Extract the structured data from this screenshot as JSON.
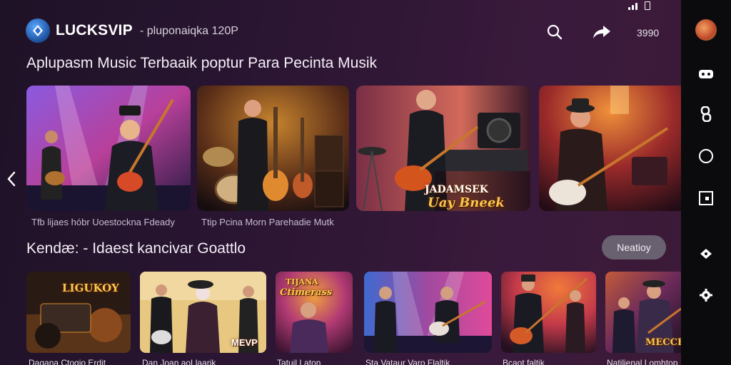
{
  "status_bar": {
    "icons": [
      "signal-icon",
      "battery-icon"
    ]
  },
  "header": {
    "app_name": "LUCKSVIP",
    "app_subtitle": "- pluponaiqka 120P",
    "count": "3990",
    "icons": [
      "search-icon",
      "share-icon"
    ]
  },
  "section1": {
    "title": "Aplupasm Music Terbaaik poptur Para Pecinta Musik",
    "cards": [
      {
        "caption": "Tfb lijaes hóbr Uoestockna Fdeady",
        "palette": [
          "#7a4fd0",
          "#d63a8e",
          "#2a2050"
        ]
      },
      {
        "caption": "Ttip Pcina Morn Parehadie Mutk",
        "palette": [
          "#6b3a20",
          "#c7842e",
          "#1a1014"
        ]
      },
      {
        "caption": "",
        "poster": "JADAMSEK\nUay Bneek",
        "palette": [
          "#a8465a",
          "#e58a4f",
          "#241426"
        ]
      },
      {
        "caption": "",
        "palette": [
          "#b83c2a",
          "#f0913a",
          "#2a1018"
        ]
      }
    ]
  },
  "section2": {
    "title": "Kendæ: - Idaest kancivar Goattlo",
    "more_label": "Neatioy",
    "cards": [
      {
        "caption": "Dagana Ctogio Erdit",
        "poster": "LIGUKOY",
        "palette": [
          "#8a4a1e",
          "#2a1a14",
          "#d88a2a"
        ]
      },
      {
        "caption": "Dan Joan aoLlaarik",
        "poster": "MEVP",
        "palette": [
          "#e0b06a",
          "#4a2a32",
          "#2a1a24"
        ]
      },
      {
        "caption": "Tatuil Laton",
        "poster": "TIJANA Ctimerass",
        "palette": [
          "#b23a74",
          "#f0a040",
          "#3a1430"
        ]
      },
      {
        "caption": "Sta Vataur Varo Flaltik",
        "palette": [
          "#3f6ad0",
          "#e04a9a",
          "#1c1634"
        ]
      },
      {
        "caption": "Bcaot faltik",
        "palette": [
          "#c43a4a",
          "#f07a3a",
          "#241020"
        ]
      },
      {
        "caption": "Natilienal Lomhtop",
        "poster": "MECCE",
        "palette": [
          "#c25a3a",
          "#3a2a6a",
          "#1e1222"
        ]
      }
    ]
  },
  "rail": {
    "icons": [
      "avatar",
      "gamepad-icon",
      "link-icon",
      "home-circle-icon",
      "window-icon",
      "cast-icon",
      "settings-icon"
    ]
  },
  "colors": {
    "accent": "#3b82f6",
    "background": "#2a1532",
    "rail": "#0b0b0e",
    "button": "#6a6170"
  }
}
